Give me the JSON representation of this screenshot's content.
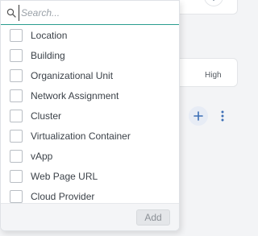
{
  "search": {
    "placeholder": "Search..."
  },
  "options": [
    {
      "label": "Location",
      "checked": false
    },
    {
      "label": "Building",
      "checked": false
    },
    {
      "label": "Organizational Unit",
      "checked": false
    },
    {
      "label": "Network Assignment",
      "checked": false
    },
    {
      "label": "Cluster",
      "checked": false
    },
    {
      "label": "Virtualization Container",
      "checked": false
    },
    {
      "label": "vApp",
      "checked": false
    },
    {
      "label": "Web Page URL",
      "checked": false
    },
    {
      "label": "Cloud Provider",
      "checked": false
    }
  ],
  "footer": {
    "add_label": "Add"
  },
  "background": {
    "priority_value": "High"
  },
  "colors": {
    "accent_underline": "#2a9d8f",
    "add_circle_bg": "#e7ecf5",
    "add_icon": "#3d6fb6"
  },
  "icons": {
    "search": "search-icon",
    "add": "plus-icon",
    "more": "kebab-icon"
  }
}
